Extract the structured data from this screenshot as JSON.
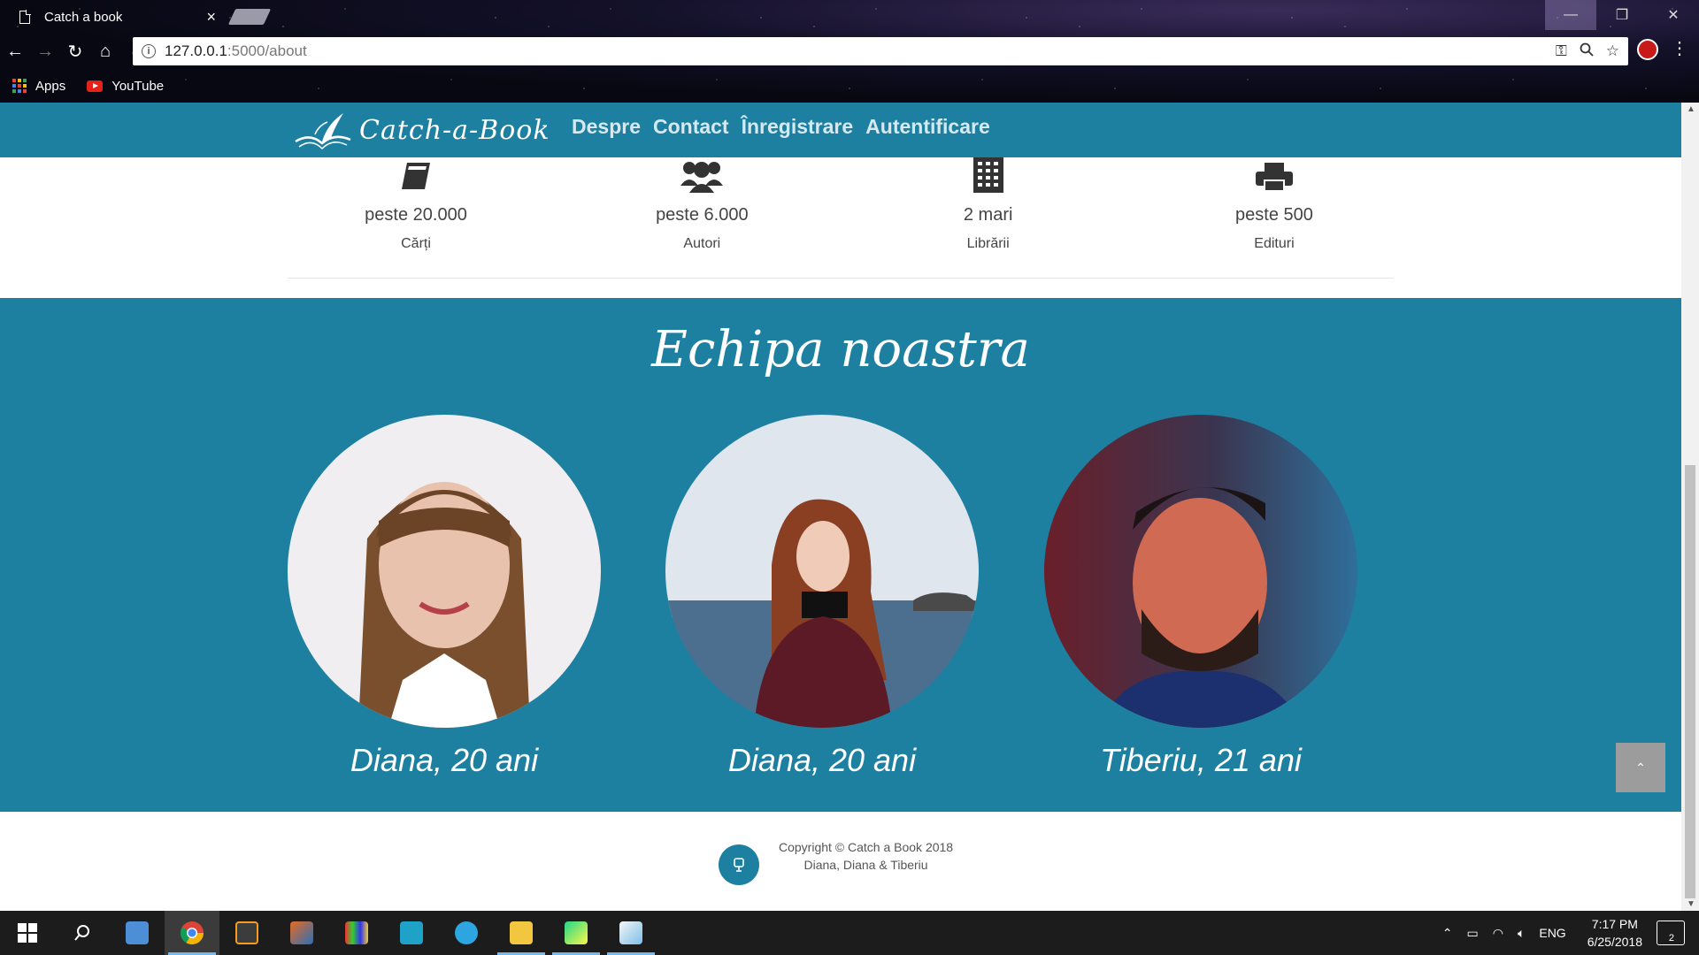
{
  "browser": {
    "tab_title": "Catch a book",
    "tab_close": "×",
    "window_controls": {
      "minimize": "—",
      "maximize": "❐",
      "close": "✕"
    },
    "url_host": "127.0.0.1",
    "url_path": ":5000/about",
    "bookmarks": [
      {
        "label": "Apps",
        "icon": "apps-grid-icon"
      },
      {
        "label": "YouTube",
        "icon": "youtube-icon"
      }
    ]
  },
  "site": {
    "logo_text": "Catch-a-Book",
    "nav": [
      "Despre",
      "Contact",
      "Înregistrare",
      "Autentificare"
    ]
  },
  "stats": [
    {
      "icon": "book-icon",
      "value": "peste 20.000",
      "label": "Cărți"
    },
    {
      "icon": "users-icon",
      "value": "peste 6.000",
      "label": "Autori"
    },
    {
      "icon": "building-icon",
      "value": "2 mari",
      "label": "Librării"
    },
    {
      "icon": "print-icon",
      "value": "peste 500",
      "label": "Edituri"
    }
  ],
  "team": {
    "title": "Echipa noastra",
    "members": [
      {
        "name": "Diana, 20 ani"
      },
      {
        "name": "Diana, 20 ani"
      },
      {
        "name": "Tiberiu, 21 ani"
      }
    ]
  },
  "footer": {
    "copyright": "Copyright © Catch a Book 2018",
    "authors": "Diana, Diana & Tiberiu",
    "back_to_top": "⌃"
  },
  "taskbar": {
    "language": "ENG",
    "time": "7:17 PM",
    "date": "6/25/2018",
    "notification_count": "2"
  },
  "colors": {
    "brand": "#1d80a0",
    "footer_text": "#555555"
  }
}
